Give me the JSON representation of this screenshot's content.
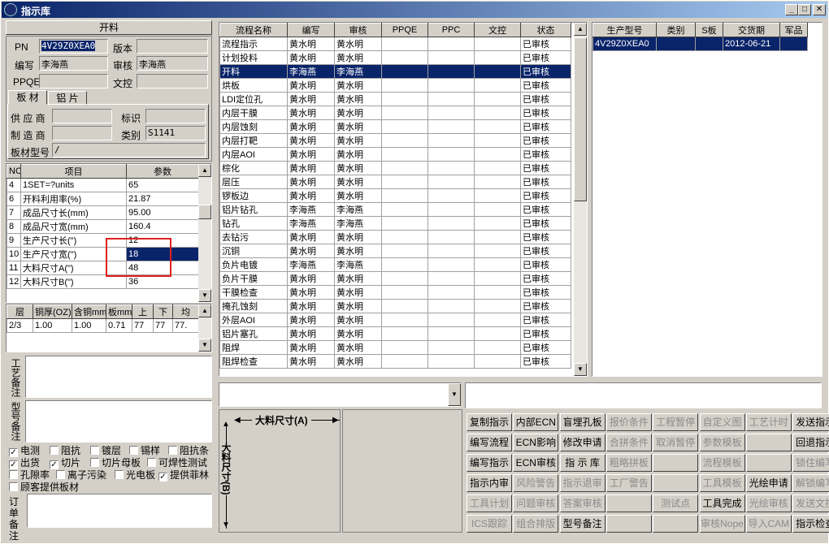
{
  "window": {
    "title": "指示库"
  },
  "left": {
    "section_title": "开料",
    "pn_label": "PN",
    "pn_value": "4V29Z0XEA0",
    "version_label": "版本",
    "version_value": "",
    "editor_label": "编写",
    "editor_value": "李海燕",
    "reviewer_label": "审核",
    "reviewer_value": "李海燕",
    "ppqe_label": "PPQE",
    "ppqe_value": "",
    "doc_label": "文控",
    "doc_value": "",
    "tabs": [
      "板 材",
      "铝 片"
    ],
    "supplier_label": "供 应 商",
    "supplier_value": "",
    "mark_label": "标识",
    "mark_value": "",
    "maker_label": "制 造 商",
    "maker_value": "",
    "category_label": "类别",
    "category_value": "S1141",
    "model_label": "板材型号",
    "model_value": "/",
    "params_headers": [
      "NO",
      "项目",
      "参数"
    ],
    "params_rows": [
      [
        "4",
        "1SET=?units",
        "65"
      ],
      [
        "6",
        "开料利用率(%)",
        "21.87"
      ],
      [
        "7",
        "成品尺寸长(mm)",
        "95.00"
      ],
      [
        "8",
        "成品尺寸宽(mm)",
        "160.4"
      ],
      [
        "9",
        "生产尺寸长(\")",
        "12"
      ],
      [
        "10",
        "生产尺寸宽(\")",
        "18"
      ],
      [
        "11",
        "大料尺寸A(\")",
        "48"
      ],
      [
        "12",
        "大料尺寸B(\")",
        "36"
      ]
    ],
    "layer_headers": [
      "层",
      "铜厚(OZ)",
      "含铜mm",
      "板mm",
      "上",
      "下",
      "均"
    ],
    "layer_rows": [
      [
        "2/3",
        "1.00",
        "1.00",
        "0.71",
        "77",
        "77",
        "77."
      ]
    ],
    "process_note_label": "工艺备注",
    "model_note_label": "型号备注",
    "checkboxes": [
      {
        "label": "电测",
        "checked": true
      },
      {
        "label": "阻抗",
        "checked": false
      },
      {
        "label": "镀层",
        "checked": false
      },
      {
        "label": "锡样",
        "checked": false
      },
      {
        "label": "阻抗条",
        "checked": false
      },
      {
        "label": "出货",
        "checked": true
      },
      {
        "label": "切片",
        "checked": true
      },
      {
        "label": "切片母板",
        "checked": false
      },
      {
        "label": "可焊性测试",
        "checked": false
      },
      {
        "label": "孔隙率",
        "checked": false
      },
      {
        "label": "离子污染",
        "checked": false
      },
      {
        "label": "光电板",
        "checked": false
      },
      {
        "label": "提供菲林",
        "checked": true
      },
      {
        "label": "顾客提供板材",
        "checked": false
      }
    ],
    "order_note_label": "订单备注"
  },
  "flow": {
    "headers": [
      "流程名称",
      "编写",
      "审核",
      "PPQE",
      "PPC",
      "文控",
      "状态"
    ],
    "rows": [
      [
        "流程指示",
        "黄水明",
        "黄水明",
        "",
        "",
        "",
        "已审核"
      ],
      [
        "计划投料",
        "黄水明",
        "黄水明",
        "",
        "",
        "",
        "已审核"
      ],
      [
        "开料",
        "李海燕",
        "李海燕",
        "",
        "",
        "",
        "已审核"
      ],
      [
        "烘板",
        "黄水明",
        "黄水明",
        "",
        "",
        "",
        "已审核"
      ],
      [
        "LDI定位孔",
        "黄水明",
        "黄水明",
        "",
        "",
        "",
        "已审核"
      ],
      [
        "内层干膜",
        "黄水明",
        "黄水明",
        "",
        "",
        "",
        "已审核"
      ],
      [
        "内层蚀刻",
        "黄水明",
        "黄水明",
        "",
        "",
        "",
        "已审核"
      ],
      [
        "内层打靶",
        "黄水明",
        "黄水明",
        "",
        "",
        "",
        "已审核"
      ],
      [
        "内层AOI",
        "黄水明",
        "黄水明",
        "",
        "",
        "",
        "已审核"
      ],
      [
        "棕化",
        "黄水明",
        "黄水明",
        "",
        "",
        "",
        "已审核"
      ],
      [
        "层压",
        "黄水明",
        "黄水明",
        "",
        "",
        "",
        "已审核"
      ],
      [
        "锣板边",
        "黄水明",
        "黄水明",
        "",
        "",
        "",
        "已审核"
      ],
      [
        "铝片钻孔",
        "李海燕",
        "李海燕",
        "",
        "",
        "",
        "已审核"
      ],
      [
        "钻孔",
        "李海燕",
        "李海燕",
        "",
        "",
        "",
        "已审核"
      ],
      [
        "去钻污",
        "黄水明",
        "黄水明",
        "",
        "",
        "",
        "已审核"
      ],
      [
        "沉铜",
        "黄水明",
        "黄水明",
        "",
        "",
        "",
        "已审核"
      ],
      [
        "负片电镀",
        "李海燕",
        "李海燕",
        "",
        "",
        "",
        "已审核"
      ],
      [
        "负片干膜",
        "黄水明",
        "黄水明",
        "",
        "",
        "",
        "已审核"
      ],
      [
        "干膜检查",
        "黄水明",
        "黄水明",
        "",
        "",
        "",
        "已审核"
      ],
      [
        "掩孔蚀刻",
        "黄水明",
        "黄水明",
        "",
        "",
        "",
        "已审核"
      ],
      [
        "外层AOI",
        "黄水明",
        "黄水明",
        "",
        "",
        "",
        "已审核"
      ],
      [
        "铝片塞孔",
        "黄水明",
        "黄水明",
        "",
        "",
        "",
        "已审核"
      ],
      [
        "阻焊",
        "黄水明",
        "黄水明",
        "",
        "",
        "",
        "已审核"
      ],
      [
        "阻焊检查",
        "黄水明",
        "黄水明",
        "",
        "",
        "",
        "已审核"
      ]
    ],
    "selected_index": 2
  },
  "right": {
    "headers": [
      "生产型号",
      "类别",
      "S板",
      "交货期",
      "军品"
    ],
    "rows": [
      [
        "4V29Z0XEA0",
        "",
        "",
        "2012-06-21",
        ""
      ]
    ]
  },
  "diagram": {
    "a_label": "大料尺寸(A)",
    "b_label": "大料尺寸(B)"
  },
  "buttons": [
    [
      "复制指示",
      "内部ECN",
      "盲埋孔板",
      "报价条件",
      "工程暂停",
      "自定义图",
      "工艺计时",
      "发送指示"
    ],
    [
      "编写流程",
      "ECN影响",
      "修改申请",
      "合拼条件",
      "取消暂停",
      "参数模板",
      "",
      "回退指示"
    ],
    [
      "编写指示",
      "ECN审核",
      "指 示 库",
      "粗略拼板",
      "",
      "流程模板",
      "",
      "锁住编写"
    ],
    [
      "指示内审",
      "风险警告",
      "指示退审",
      "工厂警告",
      "",
      "工具模板",
      "光绘申请",
      "解锁编写"
    ],
    [
      "工具计划",
      "问题审核",
      "答案审核",
      "",
      "测试点",
      "工具完成",
      "光绘审核",
      "发送文控"
    ],
    [
      "ICS跟踪",
      "组合排版",
      "型号备注",
      "",
      "",
      "审核Nope",
      "导入CAM",
      "指示检查"
    ]
  ],
  "buttons_disabled": [
    [
      false,
      false,
      false,
      true,
      true,
      true,
      true,
      false
    ],
    [
      false,
      false,
      false,
      true,
      true,
      true,
      false,
      false
    ],
    [
      false,
      false,
      false,
      true,
      false,
      true,
      false,
      true
    ],
    [
      false,
      true,
      true,
      true,
      false,
      true,
      false,
      true
    ],
    [
      true,
      true,
      true,
      false,
      true,
      false,
      true,
      true
    ],
    [
      true,
      true,
      false,
      false,
      false,
      true,
      true,
      false
    ]
  ]
}
